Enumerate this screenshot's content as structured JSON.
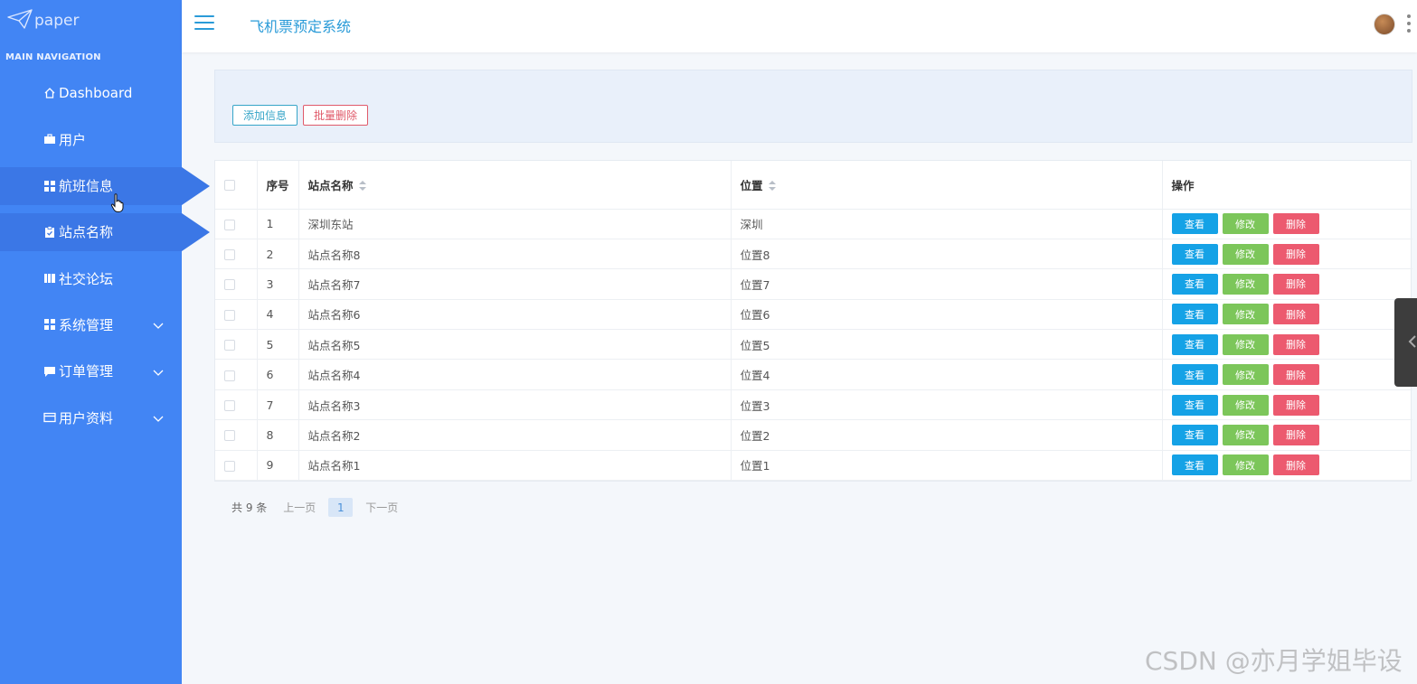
{
  "brand": {
    "logo_text": "paper"
  },
  "sidebar": {
    "caption": "MAIN NAVIGATION",
    "items": [
      {
        "label": "Dashboard",
        "icon": "home-icon"
      },
      {
        "label": "用户",
        "icon": "briefcase-icon"
      },
      {
        "label": "航班信息",
        "icon": "grid-icon",
        "active": true
      },
      {
        "label": "站点名称",
        "icon": "clipboard-icon",
        "active": true
      },
      {
        "label": "社交论坛",
        "icon": "book-icon"
      },
      {
        "label": "系统管理",
        "icon": "grid-icon",
        "expandable": true
      },
      {
        "label": "订单管理",
        "icon": "comment-icon",
        "expandable": true
      },
      {
        "label": "用户资料",
        "icon": "card-icon",
        "expandable": true
      }
    ]
  },
  "header": {
    "title": "飞机票预定系统"
  },
  "toolbar": {
    "add_label": "添加信息",
    "batch_delete_label": "批量删除"
  },
  "table": {
    "columns": [
      "序号",
      "站点名称",
      "位置",
      "操作"
    ],
    "actions": {
      "view": "查看",
      "edit": "修改",
      "delete": "删除"
    },
    "rows": [
      {
        "index": "1",
        "name": "深圳东站",
        "location": "深圳"
      },
      {
        "index": "2",
        "name": "站点名称8",
        "location": "位置8"
      },
      {
        "index": "3",
        "name": "站点名称7",
        "location": "位置7"
      },
      {
        "index": "4",
        "name": "站点名称6",
        "location": "位置6"
      },
      {
        "index": "5",
        "name": "站点名称5",
        "location": "位置5"
      },
      {
        "index": "6",
        "name": "站点名称4",
        "location": "位置4"
      },
      {
        "index": "7",
        "name": "站点名称3",
        "location": "位置3"
      },
      {
        "index": "8",
        "name": "站点名称2",
        "location": "位置2"
      },
      {
        "index": "9",
        "name": "站点名称1",
        "location": "位置1"
      }
    ]
  },
  "pagination": {
    "total": "共 9 条",
    "prev": "上一页",
    "current": "1",
    "next": "下一页"
  },
  "watermark": "CSDN @亦月学姐毕设",
  "colors": {
    "sidebar": "#4285f4",
    "sidebar_active": "#3b77e6",
    "title": "#2a9bd8",
    "view": "#15a2e6",
    "edit": "#7cc65a",
    "delete": "#ec5a6f"
  }
}
